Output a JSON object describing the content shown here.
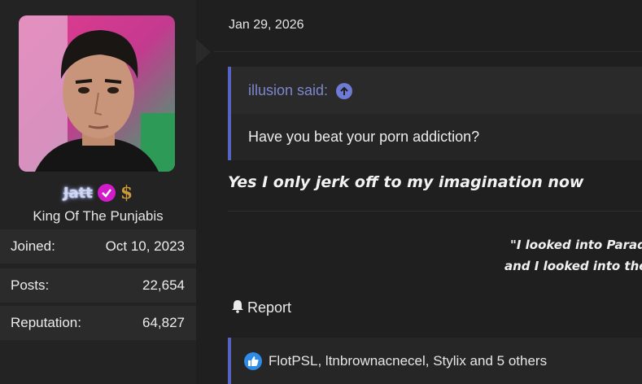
{
  "user": {
    "username": "Jatt",
    "title": "King Of The Punjabis",
    "stats": [
      {
        "label": "Joined:",
        "value": "Oct 10, 2023"
      },
      {
        "label": "Posts:",
        "value": "22,654"
      },
      {
        "label": "Reputation:",
        "value": "64,827"
      }
    ]
  },
  "post": {
    "date": "Jan 29, 2026",
    "quote": {
      "author": "illusion said:",
      "text": "Have you beat your porn addiction?"
    },
    "reply": "Yes I only jerk off to my imagination now",
    "signature": {
      "line1": "\"I looked into Parad",
      "line2": "and I looked into the"
    },
    "report_label": "Report",
    "reactions_text": "FlotPSL, ltnbrownacnecel, Stylix and 5 others"
  },
  "colors": {
    "accent": "#5563c4",
    "verified_badge": "#d21cc9",
    "like": "#2f8be8"
  }
}
